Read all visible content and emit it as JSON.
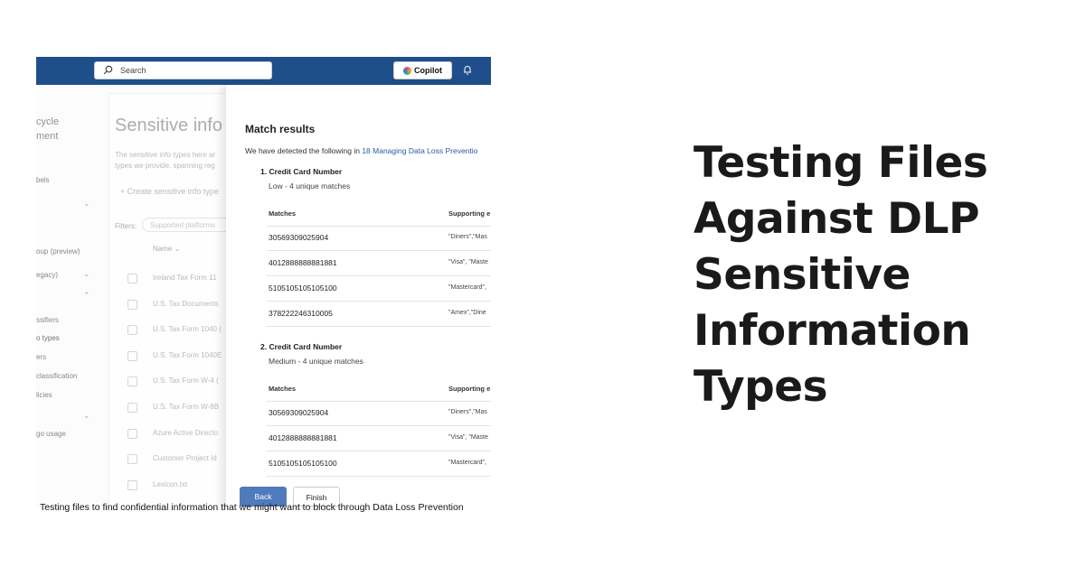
{
  "topbar": {
    "search_placeholder": "Search",
    "copilot_label": "Copilot"
  },
  "nav": {
    "items": [
      "cycle",
      "ment",
      "bels",
      "oup (preview)",
      "egacy)",
      "ssifiers",
      "o types",
      "ers",
      "classification",
      "licies",
      "go usage"
    ]
  },
  "background": {
    "title": "Sensitive info",
    "desc_line1": "The sensitive info types here ar",
    "desc_line2": "types we provide, spanning reg",
    "create_label": "Create sensitive info type",
    "filters_label": "Filters:",
    "filter_pill": "Supported platforms",
    "name_header": "Name",
    "rows": [
      "Ireland Tax Form 11",
      "U.S. Tax Documents",
      "U.S. Tax Form 1040 (",
      "U.S. Tax Form 1040E",
      "U.S. Tax Form W-4 (",
      "U.S. Tax Form W-8B",
      "Azure Active Directo",
      "Customer Project Id",
      "Lexicon.txt"
    ]
  },
  "panel": {
    "heading": "Match results",
    "detected_prefix": "We have detected the following in",
    "detected_link": "18 Managing Data Loss Preventio",
    "columns": {
      "matches": "Matches",
      "evidence": "Supporting e"
    },
    "sections": [
      {
        "title": "1. Credit Card Number",
        "subtitle": "Low - 4 unique matches",
        "rows": [
          {
            "match": "30569309025904",
            "evidence": "\"Diners\",\"Mas"
          },
          {
            "match": "4012888888881881",
            "evidence": "\"Visa\", \"Maste"
          },
          {
            "match": "5105105105105100",
            "evidence": "\"Mastercard\","
          },
          {
            "match": "378222246310005",
            "evidence": "\"Amex\",\"Dine"
          }
        ]
      },
      {
        "title": "2. Credit Card Number",
        "subtitle": "Medium - 4 unique matches",
        "rows": [
          {
            "match": "30569309025904",
            "evidence": "\"Diners\",\"Mas"
          },
          {
            "match": "4012888888881881",
            "evidence": "\"Visa\", \"Maste"
          },
          {
            "match": "5105105105105100",
            "evidence": "\"Mastercard\","
          }
        ]
      }
    ],
    "back_label": "Back",
    "finish_label": "Finish"
  },
  "caption": "Testing files to find confidential information that we might want to block through Data Loss Prevention",
  "headline": [
    "Testing Files",
    "Against DLP",
    "Sensitive",
    "Information",
    "Types"
  ],
  "colors": {
    "topbar": "#1f4f8b",
    "link": "#2a5aa7",
    "primary_button": "#4f7bbd"
  }
}
